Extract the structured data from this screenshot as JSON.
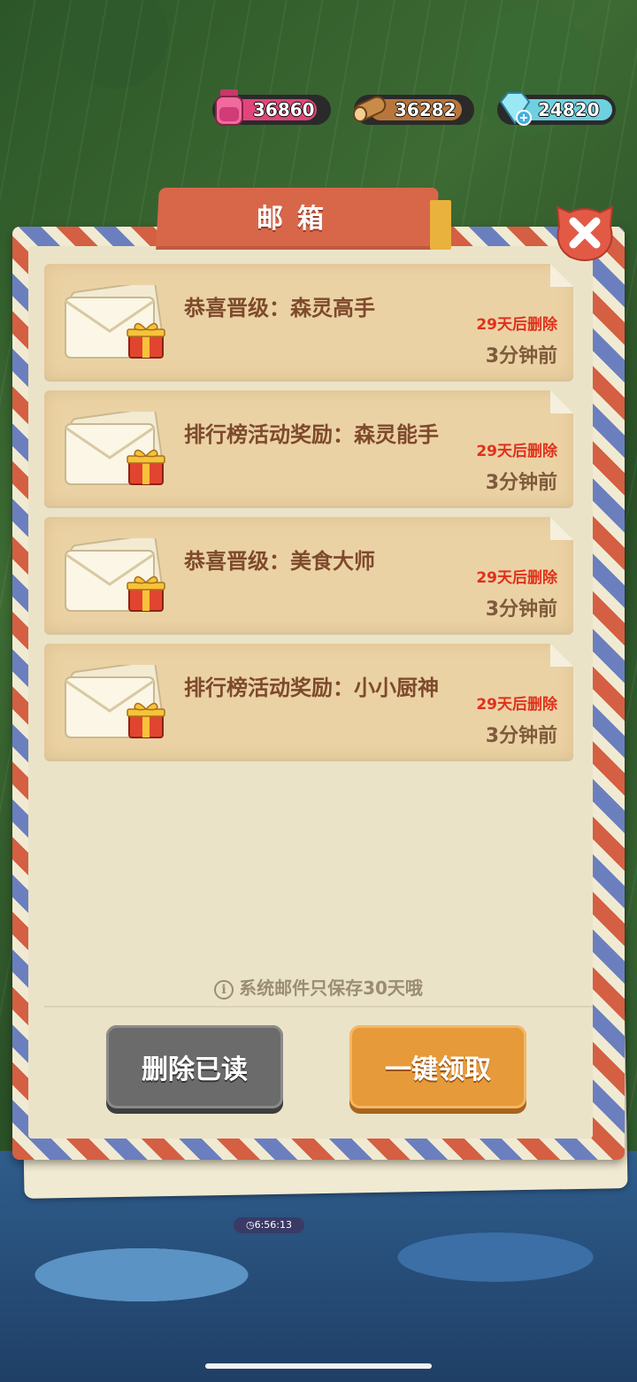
{
  "resources": {
    "potion": {
      "value": "36860",
      "icon": "potion-icon",
      "color": "#e0467a"
    },
    "wood": {
      "value": "36282",
      "icon": "wood-log-icon",
      "color": "#b8763c"
    },
    "diamond": {
      "value": "24820",
      "icon": "diamond-icon",
      "color": "#6fd0e0"
    }
  },
  "mailbox": {
    "title": "邮箱",
    "close_icon": "close-icon",
    "mails": [
      {
        "subject": "恭喜晋级：森灵高手",
        "expire": "29天后删除",
        "time": "3分钟前"
      },
      {
        "subject": "排行榜活动奖励：森灵能手",
        "expire": "29天后删除",
        "time": "3分钟前"
      },
      {
        "subject": "恭喜晋级：美食大师",
        "expire": "29天后删除",
        "time": "3分钟前"
      },
      {
        "subject": "排行榜活动奖励：小小厨神",
        "expire": "29天后删除",
        "time": "3分钟前"
      }
    ],
    "notice": "系统邮件只保存30天哦",
    "delete_read_label": "删除已读",
    "claim_all_label": "一键领取"
  },
  "background": {
    "timer": "6:56:13"
  }
}
